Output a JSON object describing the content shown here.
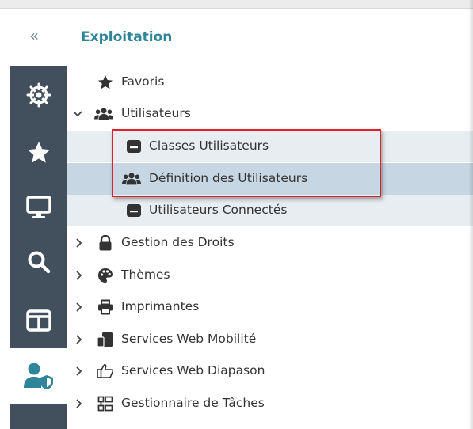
{
  "header": {
    "collapse_glyph": "«",
    "section_title": "Exploitation"
  },
  "sidebar": {
    "items": [
      {
        "icon": "helm-icon"
      },
      {
        "icon": "star-icon"
      },
      {
        "icon": "monitor-icon"
      },
      {
        "icon": "search-icon"
      },
      {
        "icon": "layout-icon"
      },
      {
        "icon": "user-shield-icon",
        "active": true
      }
    ]
  },
  "tree": {
    "favoris": "Favoris",
    "utilisateurs": "Utilisateurs",
    "classes_utilisateurs": "Classes Utilisateurs",
    "definition_utilisateurs": "Définition des Utilisateurs",
    "utilisateurs_connectes": "Utilisateurs Connectés",
    "gestion_droits": "Gestion des Droits",
    "themes": "Thèmes",
    "imprimantes": "Imprimantes",
    "services_web_mobilite": "Services Web Mobilité",
    "services_web_diapason": "Services Web Diapason",
    "gestionnaire_taches": "Gestionnaire de Tâches"
  },
  "colors": {
    "sidebar": "#41505c",
    "accent": "#2f8599",
    "highlight": "#e0202a",
    "selected_row": "#c6d6e3"
  }
}
